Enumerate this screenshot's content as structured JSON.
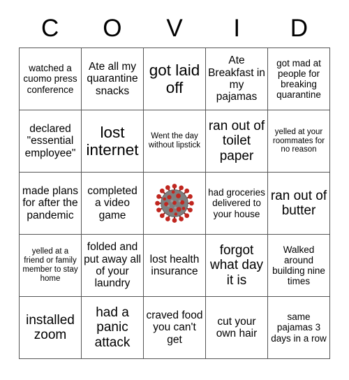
{
  "board": {
    "title_letters": [
      "C",
      "O",
      "V",
      "I",
      "D"
    ],
    "free_space": {
      "icon": "coronavirus-icon",
      "colors": {
        "spike": "#c0261f",
        "spike_dark": "#8f1a15",
        "body": "#7f7f7f",
        "body_dark": "#5e5e5e"
      }
    },
    "colors": {
      "background": "#ffffff",
      "border": "#555555",
      "text": "#000000"
    },
    "rows": [
      [
        {
          "text": "watched a cuomo press conference",
          "size": "fs-sm"
        },
        {
          "text": "Ate all my quarantine snacks",
          "size": "fs-md"
        },
        {
          "text": "got laid off",
          "size": "fs-xl"
        },
        {
          "text": "Ate Breakfast in my pajamas",
          "size": "fs-md"
        },
        {
          "text": "got mad at people for breaking quarantine",
          "size": "fs-sm"
        }
      ],
      [
        {
          "text": "declared \"essential employee\"",
          "size": "fs-md"
        },
        {
          "text": "lost internet",
          "size": "fs-xl"
        },
        {
          "text": "Went the day without lipstick",
          "size": "fs-xs"
        },
        {
          "text": "ran out of toilet paper",
          "size": "fs-lg"
        },
        {
          "text": "yelled at your roommates for no reason",
          "size": "fs-xs"
        }
      ],
      [
        {
          "text": "made plans for after the pandemic",
          "size": "fs-md"
        },
        {
          "text": "completed a video game",
          "size": "fs-md"
        },
        {
          "text": "",
          "size": "free"
        },
        {
          "text": "had groceries delivered to your house",
          "size": "fs-sm"
        },
        {
          "text": "ran out of butter",
          "size": "fs-lg"
        }
      ],
      [
        {
          "text": "yelled at a friend or family member to stay home",
          "size": "fs-xs"
        },
        {
          "text": "folded and put away all of your laundry",
          "size": "fs-md"
        },
        {
          "text": "lost health insurance",
          "size": "fs-md"
        },
        {
          "text": "forgot what day it is",
          "size": "fs-lg"
        },
        {
          "text": "Walked around building nine times",
          "size": "fs-sm"
        }
      ],
      [
        {
          "text": "installed zoom",
          "size": "fs-lg"
        },
        {
          "text": "had a panic attack",
          "size": "fs-lg"
        },
        {
          "text": "craved food you can't get",
          "size": "fs-md"
        },
        {
          "text": "cut your own hair",
          "size": "fs-md"
        },
        {
          "text": "same pajamas 3 days in a row",
          "size": "fs-sm"
        }
      ]
    ]
  }
}
